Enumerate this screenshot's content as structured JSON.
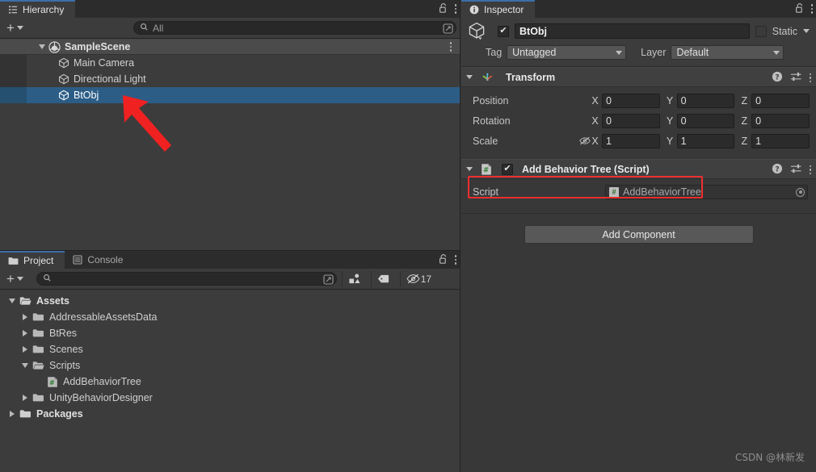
{
  "hierarchy": {
    "tab_label": "Hierarchy",
    "tab_icon": "hierarchy-icon",
    "lock_icon": "lock-open-icon",
    "menu_icon": "kebab-menu-icon",
    "create_label": "+",
    "search_placeholder": "All",
    "search_value": "",
    "rows": [
      {
        "label": "SampleScene",
        "icon": "unity-scene-icon",
        "indent": 1,
        "expanded": true,
        "selected": false,
        "type": "scene"
      },
      {
        "label": "Main Camera",
        "icon": "gameobject-cube-icon",
        "indent": 2,
        "expanded": null,
        "selected": false,
        "type": "object"
      },
      {
        "label": "Directional Light",
        "icon": "gameobject-cube-icon",
        "indent": 2,
        "expanded": null,
        "selected": false,
        "type": "object"
      },
      {
        "label": "BtObj",
        "icon": "gameobject-cube-icon",
        "indent": 2,
        "expanded": null,
        "selected": true,
        "type": "object"
      }
    ]
  },
  "project": {
    "tabs": [
      {
        "label": "Project",
        "icon": "folder-icon",
        "active": true
      },
      {
        "label": "Console",
        "icon": "console-icon",
        "active": false
      }
    ],
    "lock_icon": "lock-open-icon",
    "menu_icon": "kebab-menu-icon",
    "create_label": "+",
    "search_placeholder": "",
    "search_value": "",
    "toolbar_icons": [
      "asset-filter-icon",
      "label-tag-icon"
    ],
    "hidden_count": "17",
    "rows": [
      {
        "label": "Assets",
        "icon": "folder-open-icon",
        "indent": 0,
        "state": "expanded",
        "bold": true
      },
      {
        "label": "AddressableAssetsData",
        "icon": "folder-icon",
        "indent": 1,
        "state": "collapsed",
        "bold": false
      },
      {
        "label": "BtRes",
        "icon": "folder-icon",
        "indent": 1,
        "state": "collapsed",
        "bold": false
      },
      {
        "label": "Scenes",
        "icon": "folder-icon",
        "indent": 1,
        "state": "collapsed",
        "bold": false
      },
      {
        "label": "Scripts",
        "icon": "folder-open-icon",
        "indent": 1,
        "state": "expanded",
        "bold": false
      },
      {
        "label": "AddBehaviorTree",
        "icon": "csharp-script-icon",
        "indent": 2,
        "state": "leaf",
        "bold": false
      },
      {
        "label": "UnityBehaviorDesigner",
        "icon": "folder-icon",
        "indent": 1,
        "state": "collapsed",
        "bold": false
      },
      {
        "label": "Packages",
        "icon": "folder-icon",
        "indent": 0,
        "state": "collapsed",
        "bold": true
      }
    ]
  },
  "inspector": {
    "tab_label": "Inspector",
    "tab_icon": "info-circle-icon",
    "lock_icon": "lock-open-icon",
    "menu_icon": "kebab-menu-icon",
    "object_icon": "gameobject-cube-icon",
    "enabled": true,
    "name_value": "BtObj",
    "static_label": "Static",
    "static_checked": false,
    "tag_label": "Tag",
    "tag_value": "Untagged",
    "layer_label": "Layer",
    "layer_value": "Default",
    "transform": {
      "title": "Transform",
      "icon": "transform-axis-icon",
      "expanded": true,
      "help_icon": "help-circle-icon",
      "preset_icon": "preset-settings-icon",
      "menu_icon": "kebab-menu-icon",
      "rows": [
        {
          "label": "Position",
          "x": "0",
          "y": "0",
          "z": "0",
          "extra_icon": null
        },
        {
          "label": "Rotation",
          "x": "0",
          "y": "0",
          "z": "0",
          "extra_icon": null
        },
        {
          "label": "Scale",
          "x": "1",
          "y": "1",
          "z": "1",
          "extra_icon": "constrain-proportions-off-icon"
        }
      ],
      "axes": [
        "X",
        "Y",
        "Z"
      ]
    },
    "script_component": {
      "title": "Add Behavior Tree (Script)",
      "icon": "csharp-script-icon",
      "expanded": true,
      "enabled": true,
      "highlighted": true,
      "highlight_color": "#ef2f2f",
      "help_icon": "help-circle-icon",
      "preset_icon": "preset-settings-icon",
      "menu_icon": "kebab-menu-icon",
      "field_label": "Script",
      "field_value": "AddBehaviorTree",
      "field_icon": "csharp-script-icon",
      "picker_icon": "object-picker-icon"
    },
    "add_component_label": "Add Component"
  },
  "annotation": {
    "arrow_color": "#ef2121",
    "arrow_name": "red-pointer-arrow"
  },
  "watermark": {
    "text": "CSDN @林新发"
  },
  "colors": {
    "selection_blue": "#2c5d87",
    "panel_bg": "#3c3c3c",
    "inspector_bg": "#383838",
    "tabbar_bg": "#2c2c2c",
    "accent_red": "#ef2f2f"
  }
}
